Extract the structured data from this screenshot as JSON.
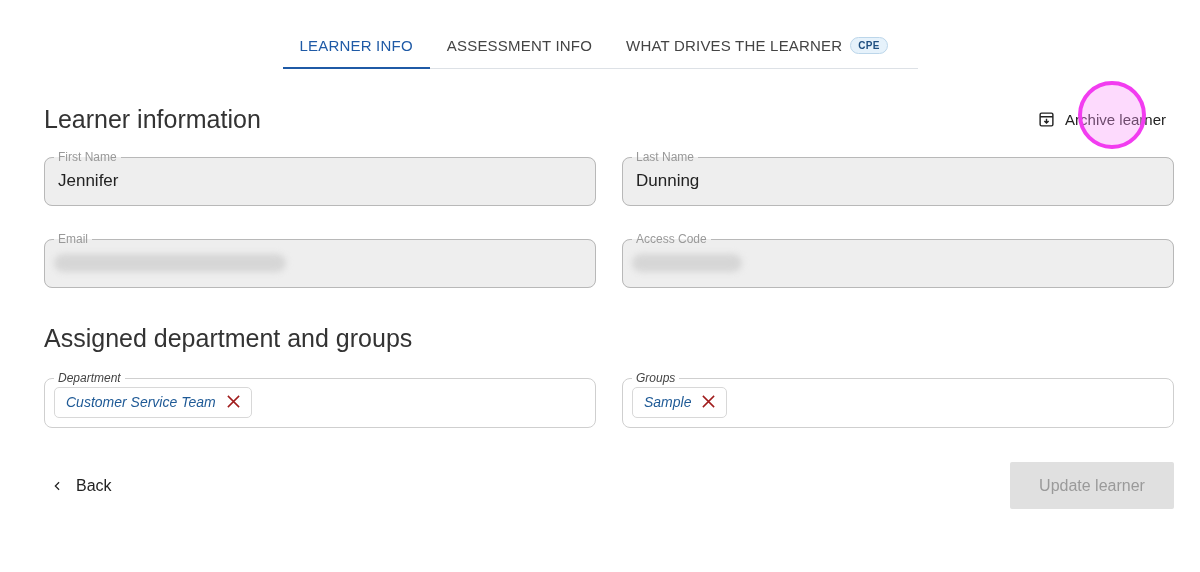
{
  "tabs": [
    {
      "label": "LEARNER INFO",
      "selected": true
    },
    {
      "label": "ASSESSMENT INFO",
      "selected": false
    },
    {
      "label": "WHAT DRIVES THE LEARNER",
      "selected": false,
      "badge": "CPE"
    }
  ],
  "learner_section": {
    "title": "Learner information",
    "archive_action": "Archive learner",
    "fields": [
      {
        "label": "First Name",
        "value": "Jennifer",
        "disabled": true
      },
      {
        "label": "Last Name",
        "value": "Dunning",
        "disabled": true
      },
      {
        "label": "Email",
        "redacted": true,
        "disabled": true
      },
      {
        "label": "Access Code",
        "redacted": true,
        "disabled": true
      }
    ]
  },
  "assignment_section": {
    "title": "Assigned department and groups",
    "fields": [
      {
        "label": "Department",
        "tags": [
          "Customer Service Team"
        ],
        "disabled": false
      },
      {
        "label": "Groups",
        "tags": [
          "Sample"
        ],
        "disabled": false
      }
    ]
  },
  "footer": {
    "back": "Back",
    "submit": {
      "label": "Update learner",
      "disabled": true
    }
  },
  "click_highlight": true
}
